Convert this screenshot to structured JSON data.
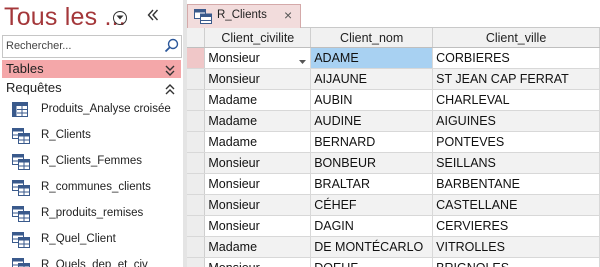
{
  "nav": {
    "title": "Tous les ...",
    "search_placeholder": "Rechercher...",
    "groups": {
      "tables": "Tables",
      "queries": "Requêtes"
    },
    "queries": [
      {
        "label": "Produits_Analyse croisée",
        "icon": "crosstab-query-icon"
      },
      {
        "label": "R_Clients",
        "icon": "select-query-icon"
      },
      {
        "label": "R_Clients_Femmes",
        "icon": "select-query-icon"
      },
      {
        "label": "R_communes_clients",
        "icon": "select-query-icon"
      },
      {
        "label": "R_produits_remises",
        "icon": "select-query-icon"
      },
      {
        "label": "R_Quel_Client",
        "icon": "select-query-icon"
      },
      {
        "label": "R_Quels_dep_et_civ",
        "icon": "select-query-icon"
      }
    ]
  },
  "tab": {
    "label": "R_Clients",
    "close": "×"
  },
  "datasheet": {
    "columns": [
      "Client_civilite",
      "Client_nom",
      "Client_ville"
    ],
    "rows": [
      [
        "Monsieur",
        "ADAME",
        "CORBIERES"
      ],
      [
        "Monsieur",
        "AIJAUNE",
        "ST JEAN CAP FERRAT"
      ],
      [
        "Madame",
        "AUBIN",
        "CHARLEVAL"
      ],
      [
        "Madame",
        "AUDINE",
        "AIGUINES"
      ],
      [
        "Madame",
        "BERNARD",
        "PONTEVES"
      ],
      [
        "Monsieur",
        "BONBEUR",
        "SEILLANS"
      ],
      [
        "Monsieur",
        "BRALTAR",
        "BARBENTANE"
      ],
      [
        "Monsieur",
        "CÉHEF",
        "CASTELLANE"
      ],
      [
        "Monsieur",
        "DAGIN",
        "CERVIERES"
      ],
      [
        "Madame",
        "DE MONTÉCARLO",
        "VITROLLES"
      ],
      [
        "Monsieur",
        "DOEUF",
        "BRIGNOLES"
      ]
    ],
    "active_row": 0,
    "highlight_column": 1
  },
  "colors": {
    "nav_title": "#a4373a",
    "tables_group_bg": "#f4a7a9",
    "tab_bg": "#f2dcdc",
    "cell_highlight": "#a8d1f2",
    "selector_active": "#f0c7c8"
  }
}
